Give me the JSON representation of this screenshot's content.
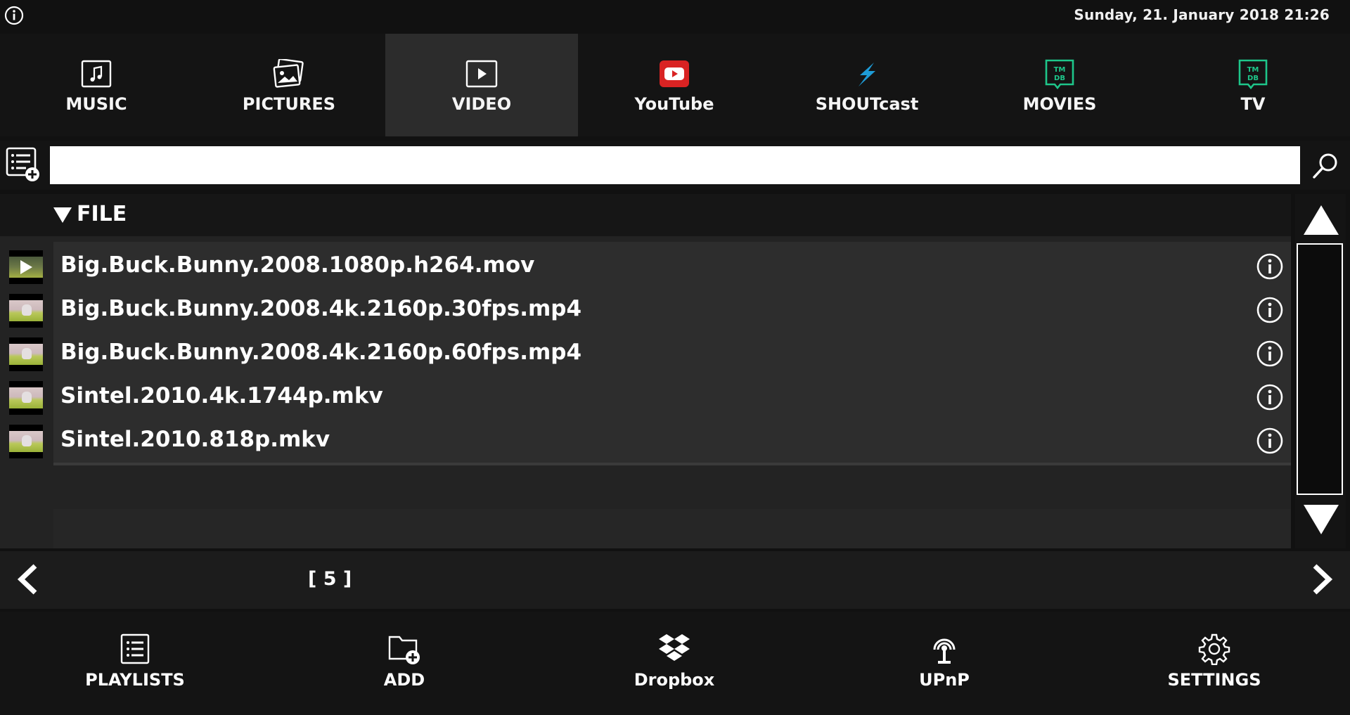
{
  "status": {
    "datetime": "Sunday, 21. January 2018 21:26",
    "info_icon": "info-circle-icon"
  },
  "tabs": [
    {
      "label": "MUSIC",
      "icon": "music-note-icon",
      "active": false
    },
    {
      "label": "PICTURES",
      "icon": "pictures-icon",
      "active": false
    },
    {
      "label": "VIDEO",
      "icon": "video-play-icon",
      "active": true
    },
    {
      "label": "YouTube",
      "icon": "youtube-icon",
      "active": false,
      "color": "#e62117"
    },
    {
      "label": "SHOUTcast",
      "icon": "shoutcast-icon",
      "active": false,
      "color": "#1e9bd6"
    },
    {
      "label": "MOVIES",
      "icon": "tmdb-icon",
      "active": false,
      "color": "#1ec68a"
    },
    {
      "label": "TV",
      "icon": "tmdb-icon",
      "active": false,
      "color": "#1ec68a"
    }
  ],
  "search": {
    "value": "",
    "placeholder": ""
  },
  "list": {
    "header": "FILE",
    "rows": [
      {
        "name": "Big.Buck.Bunny.2008.1080p.h264.mov",
        "playing": true
      },
      {
        "name": "Big.Buck.Bunny.2008.4k.2160p.30fps.mp4",
        "playing": false
      },
      {
        "name": "Big.Buck.Bunny.2008.4k.2160p.60fps.mp4",
        "playing": false
      },
      {
        "name": "Sintel.2010.4k.1744p.mkv",
        "playing": false
      },
      {
        "name": "Sintel.2010.818p.mkv",
        "playing": false
      }
    ]
  },
  "pager": {
    "count": "[ 5 ]"
  },
  "bottom": [
    {
      "label": "PLAYLISTS",
      "icon": "playlist-icon"
    },
    {
      "label": "ADD",
      "icon": "folder-add-icon"
    },
    {
      "label": "Dropbox",
      "icon": "dropbox-icon"
    },
    {
      "label": "UPnP",
      "icon": "upnp-broadcast-icon"
    },
    {
      "label": "SETTINGS",
      "icon": "gear-icon"
    }
  ]
}
